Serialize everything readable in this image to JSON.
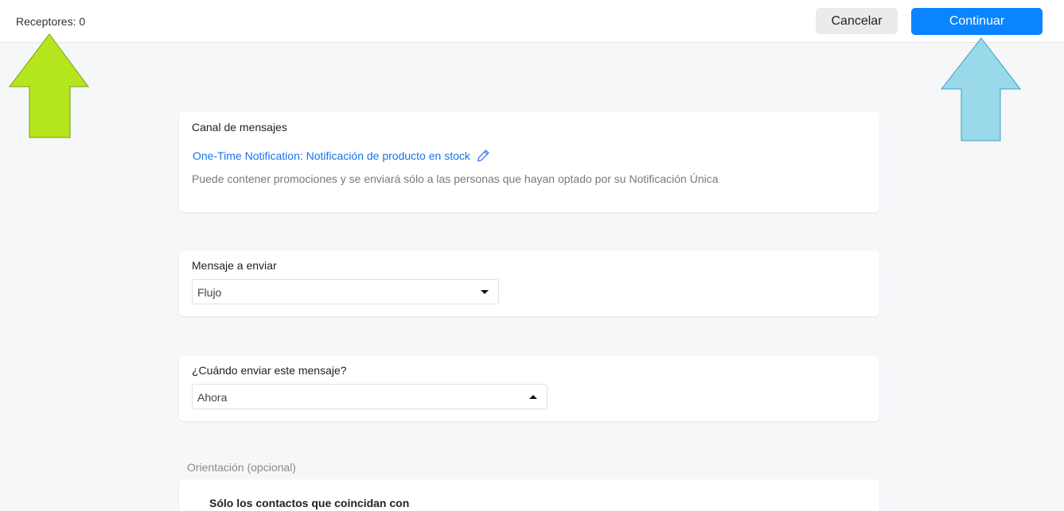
{
  "header": {
    "recipients_label": "Receptores: 0",
    "cancel_label": "Cancelar",
    "continue_label": "Continuar"
  },
  "annotations": {
    "left_arrow_color": "#b5e61d",
    "right_arrow_color": "#99d9ea"
  },
  "channel_card": {
    "title": "Canal de mensajes",
    "link_text": "One-Time Notification: Notificación de producto en stock",
    "edit_icon": "pencil-icon",
    "description": "Puede contener promociones y se enviará sólo a las personas que hayan optado por su Notificación Única"
  },
  "message_card": {
    "title": "Mensaje a enviar",
    "selected": "Flujo"
  },
  "schedule_card": {
    "title": "¿Cuándo enviar este mensaje?",
    "selected": "Ahora"
  },
  "targeting": {
    "label": "Orientación (opcional)",
    "subtitle": "Sólo los contactos que coincidan con"
  },
  "colors": {
    "accent": "#0a84ff",
    "link": "#1a73e8"
  }
}
